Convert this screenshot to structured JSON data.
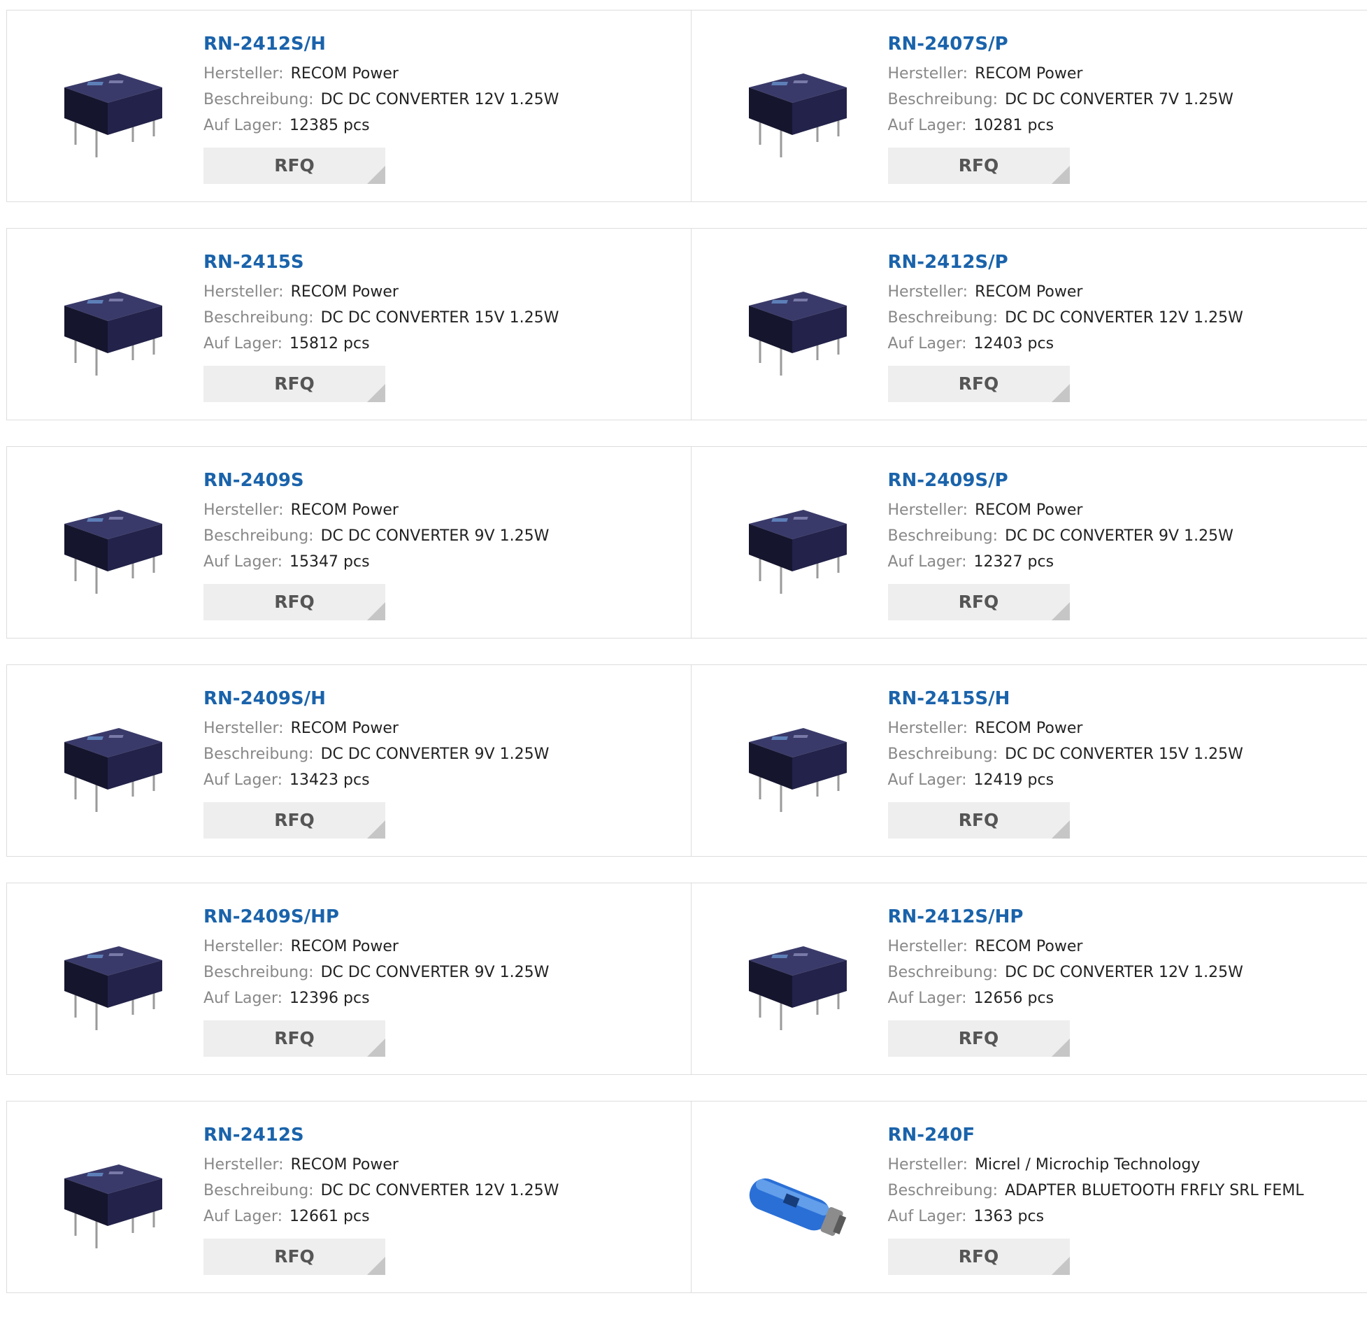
{
  "labels": {
    "manufacturer": "Hersteller:",
    "description": "Beschreibung:",
    "stock": "Auf Lager:",
    "rfq": "RFQ"
  },
  "products": [
    {
      "part": "RN-2412S/H",
      "manufacturer": "RECOM Power",
      "description": "DC DC CONVERTER 12V 1.25W",
      "stock": "12385 pcs",
      "image": "dip-module"
    },
    {
      "part": "RN-2407S/P",
      "manufacturer": "RECOM Power",
      "description": "DC DC CONVERTER 7V 1.25W",
      "stock": "10281 pcs",
      "image": "dip-module"
    },
    {
      "part": "RN-2415S",
      "manufacturer": "RECOM Power",
      "description": "DC DC CONVERTER 15V 1.25W",
      "stock": "15812 pcs",
      "image": "dip-module"
    },
    {
      "part": "RN-2412S/P",
      "manufacturer": "RECOM Power",
      "description": "DC DC CONVERTER 12V 1.25W",
      "stock": "12403 pcs",
      "image": "dip-module"
    },
    {
      "part": "RN-2409S",
      "manufacturer": "RECOM Power",
      "description": "DC DC CONVERTER 9V 1.25W",
      "stock": "15347 pcs",
      "image": "dip-module"
    },
    {
      "part": "RN-2409S/P",
      "manufacturer": "RECOM Power",
      "description": "DC DC CONVERTER 9V 1.25W",
      "stock": "12327 pcs",
      "image": "dip-module"
    },
    {
      "part": "RN-2409S/H",
      "manufacturer": "RECOM Power",
      "description": "DC DC CONVERTER 9V 1.25W",
      "stock": "13423 pcs",
      "image": "dip-module"
    },
    {
      "part": "RN-2415S/H",
      "manufacturer": "RECOM Power",
      "description": "DC DC CONVERTER 15V 1.25W",
      "stock": "12419 pcs",
      "image": "dip-module"
    },
    {
      "part": "RN-2409S/HP",
      "manufacturer": "RECOM Power",
      "description": "DC DC CONVERTER 9V 1.25W",
      "stock": "12396 pcs",
      "image": "dip-module"
    },
    {
      "part": "RN-2412S/HP",
      "manufacturer": "RECOM Power",
      "description": "DC DC CONVERTER 12V 1.25W",
      "stock": "12656 pcs",
      "image": "dip-module"
    },
    {
      "part": "RN-2412S",
      "manufacturer": "RECOM Power",
      "description": "DC DC CONVERTER 12V 1.25W",
      "stock": "12661 pcs",
      "image": "dip-module"
    },
    {
      "part": "RN-240F",
      "manufacturer": "Micrel / Microchip Technology",
      "description": "ADAPTER BLUETOOTH FRFLY SRL FEML",
      "stock": "1363 pcs",
      "image": "bluetooth-adapter"
    }
  ],
  "colors": {
    "part_link": "#1a63ab",
    "label": "#888888",
    "value": "#222222",
    "button_bg": "#eeeeee",
    "border": "#dddddd"
  }
}
